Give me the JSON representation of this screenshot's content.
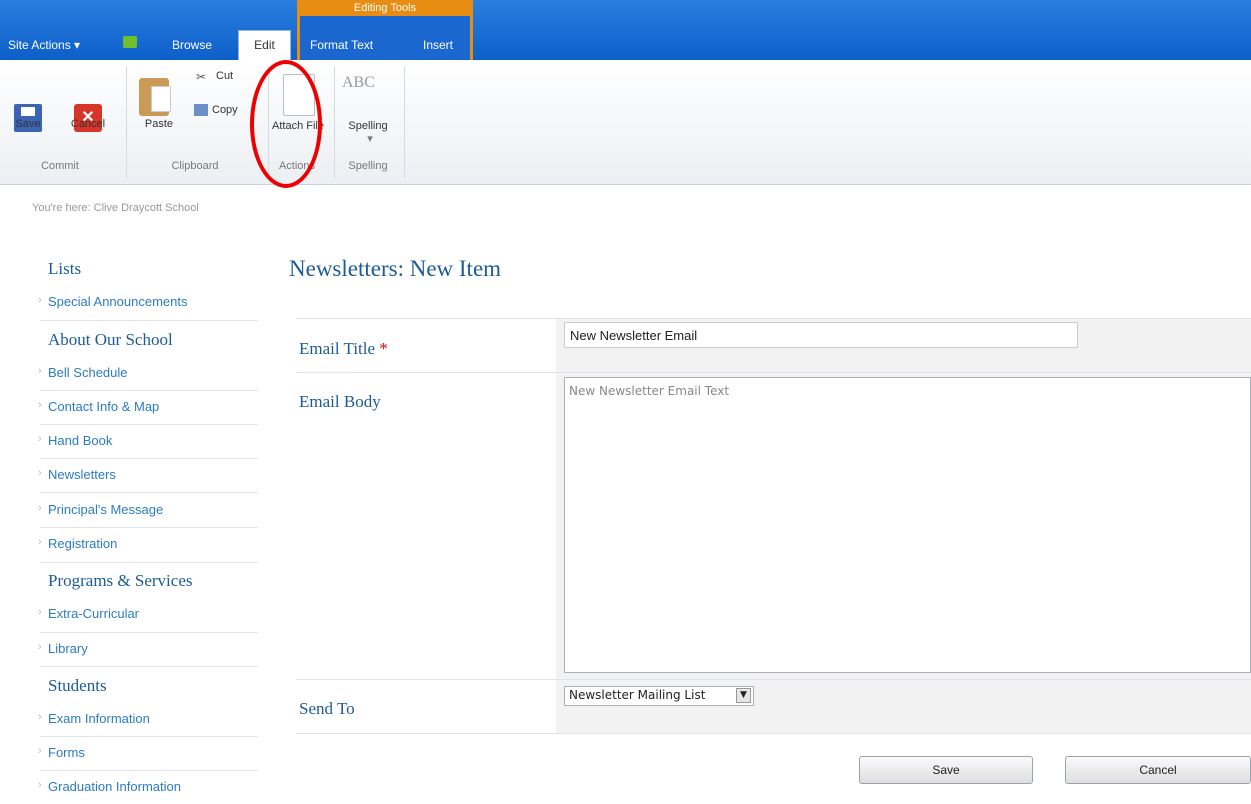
{
  "ribbon": {
    "site_actions": "Site Actions ▾",
    "tabs": {
      "browse": "Browse",
      "edit": "Edit",
      "format_text": "Format Text",
      "insert": "Insert"
    },
    "editing_tools": "Editing Tools",
    "commit": {
      "save": "Save",
      "cancel": "Cancel",
      "group": "Commit"
    },
    "clipboard": {
      "paste": "Paste",
      "cut": "Cut",
      "copy": "Copy",
      "group": "Clipboard"
    },
    "actions": {
      "attach": "Attach File",
      "group": "Actions"
    },
    "spelling": {
      "spelling": "Spelling",
      "group": "Spelling",
      "icon_text": "ABC"
    }
  },
  "breadcrumb": "You're here: Clive Draycott School",
  "nav": {
    "lists": "Lists",
    "special": "Special Announcements",
    "about": "About Our School",
    "bell": "Bell Schedule",
    "contact": "Contact Info & Map",
    "handbook": "Hand Book",
    "newsletters": "Newsletters",
    "principal": "Principal's Message",
    "registration": "Registration",
    "programs": "Programs & Services",
    "extra": "Extra-Curricular",
    "library": "Library",
    "students": "Students",
    "exam": "Exam Information",
    "forms": "Forms",
    "graduation": "Graduation Information"
  },
  "form": {
    "page_title": "Newsletters: New Item",
    "email_title_label": "Email Title",
    "required_mark": "*",
    "email_title_value": "New Newsletter Email",
    "email_body_label": "Email Body",
    "email_body_value": "New Newsletter Email Text",
    "send_to_label": "Send To",
    "send_to_value": "Newsletter Mailing List",
    "save": "Save",
    "cancel": "Cancel"
  }
}
